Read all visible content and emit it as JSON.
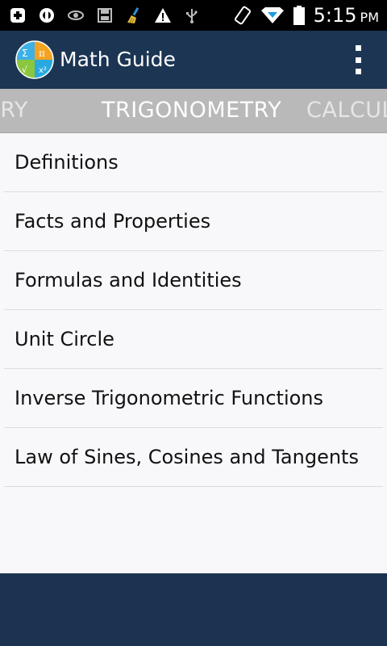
{
  "status_bar": {
    "time": "5:15",
    "ampm": "PM",
    "icons": [
      "download-icon",
      "sync-icon",
      "eye-icon",
      "save-icon",
      "broom-icon",
      "warning-icon",
      "usb-icon",
      "rotate-icon",
      "wifi-icon",
      "battery-icon"
    ]
  },
  "app_bar": {
    "title": "Math Guide",
    "logo_icon": "math-guide-logo-icon",
    "overflow_icon": "overflow-menu-icon"
  },
  "tabs": {
    "previous": "METRY",
    "current": "TRIGONOMETRY",
    "next": "CALCUL"
  },
  "list": [
    {
      "label": "Definitions"
    },
    {
      "label": "Facts and Properties"
    },
    {
      "label": "Formulas and Identities"
    },
    {
      "label": "Unit Circle"
    },
    {
      "label": "Inverse Trigonometric Functions"
    },
    {
      "label": "Law of Sines, Cosines and Tangents"
    }
  ],
  "colors": {
    "app_bar": "#1c3553",
    "tab_strip": "#b9b9b9",
    "content_bg": "#f8f8fb",
    "status_bar": "#000000"
  }
}
